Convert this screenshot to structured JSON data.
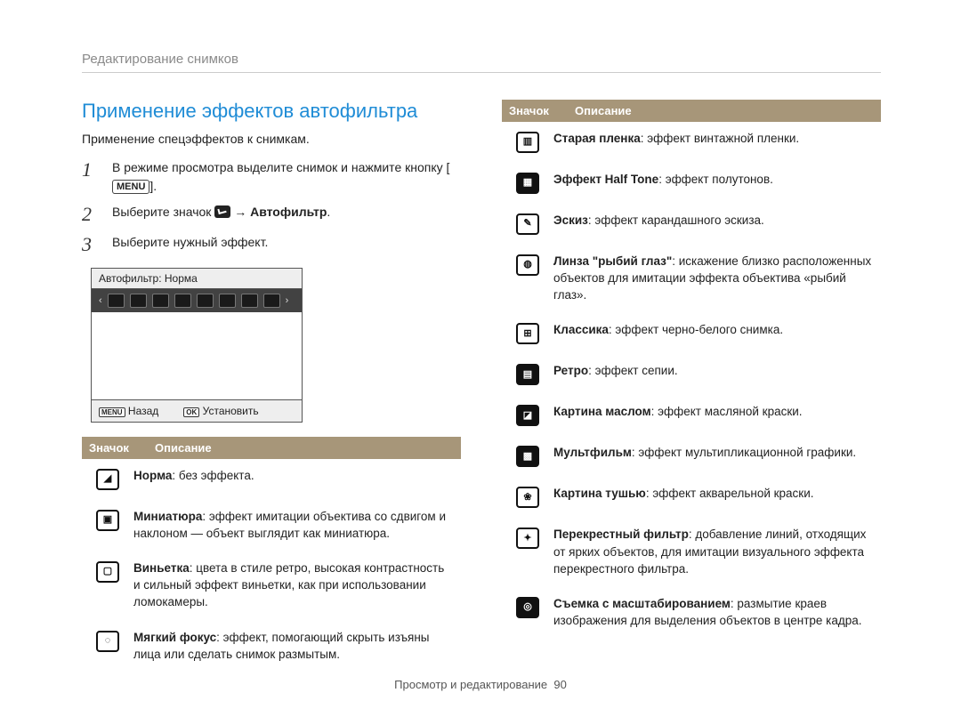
{
  "breadcrumb": "Редактирование снимков",
  "heading": "Применение эффектов автофильтра",
  "subtitle": "Применение спецэффектов к снимкам.",
  "steps": {
    "n1": "1",
    "s1a": "В режиме просмотра выделите снимок и нажмите кнопку [",
    "s1_menu": "MENU",
    "s1b": "].",
    "n2": "2",
    "s2a": "Выберите значок ",
    "s2b": " → ",
    "s2c": "Автофильтр",
    "s2d": ".",
    "n3": "3",
    "s3": "Выберите нужный эффект."
  },
  "preview": {
    "title": "Автофильтр: Норма",
    "back_chip": "MENU",
    "back_label": "Назад",
    "ok_chip": "OK",
    "ok_label": "Установить"
  },
  "tbl_head": {
    "icon": "Значок",
    "desc": "Описание"
  },
  "left_rows": [
    {
      "icon": "norma-icon",
      "bold": "Норма",
      "rest": ": без эффекта."
    },
    {
      "icon": "miniature-icon",
      "bold": "Миниатюра",
      "rest": ": эффект имитации объектива со сдвигом и наклоном — объект выглядит как миниатюра."
    },
    {
      "icon": "vignette-icon",
      "bold": "Виньетка",
      "rest": ": цвета в стиле ретро, высокая контрастность и сильный эффект виньетки, как при использовании ломокамеры."
    },
    {
      "icon": "softfocus-icon",
      "bold": "Мягкий фокус",
      "rest": ": эффект, помогающий скрыть изъяны лица или сделать снимок размытым."
    }
  ],
  "right_rows": [
    {
      "icon": "oldfilm-icon",
      "bold": "Старая пленка",
      "rest": ": эффект винтажной пленки."
    },
    {
      "icon": "halftone-icon",
      "bold": "Эффект Half Tone",
      "rest": ": эффект полутонов."
    },
    {
      "icon": "sketch-icon",
      "bold": "Эскиз",
      "rest": ": эффект карандашного эскиза."
    },
    {
      "icon": "fisheye-icon",
      "bold": "Линза \"рыбий глаз\"",
      "rest": ": искажение близко расположенных объектов для имитации эффекта объектива «рыбий глаз»."
    },
    {
      "icon": "classic-icon",
      "bold": "Классика",
      "rest": ": эффект черно-белого снимка."
    },
    {
      "icon": "retro-icon",
      "bold": "Ретро",
      "rest": ": эффект сепии."
    },
    {
      "icon": "oilpaint-icon",
      "bold": "Картина маслом",
      "rest": ": эффект масляной краски."
    },
    {
      "icon": "cartoon-icon",
      "bold": "Мультфильм",
      "rest": ": эффект мультипликационной графики."
    },
    {
      "icon": "inkpaint-icon",
      "bold": "Картина тушью",
      "rest": ": эффект акварельной краски."
    },
    {
      "icon": "crossfilter-icon",
      "bold": "Перекрестный фильтр",
      "rest": ": добавление линий, отходящих от ярких объектов, для имитации визуального эффекта перекрестного фильтра."
    },
    {
      "icon": "zoomshot-icon",
      "bold": "Съемка с масштабированием",
      "rest": ": размытие краев изображения для выделения объектов в центре кадра."
    }
  ],
  "footer": {
    "label": "Просмотр и редактирование",
    "page": "90"
  },
  "glyphs": {
    "norma-icon": "◢",
    "miniature-icon": "▣",
    "vignette-icon": "▢",
    "softfocus-icon": "◌",
    "oldfilm-icon": "▥",
    "halftone-icon": "▦",
    "sketch-icon": "✎",
    "fisheye-icon": "◍",
    "classic-icon": "⊞",
    "retro-icon": "▤",
    "oilpaint-icon": "◪",
    "cartoon-icon": "▩",
    "inkpaint-icon": "❀",
    "crossfilter-icon": "✦",
    "zoomshot-icon": "◎"
  }
}
